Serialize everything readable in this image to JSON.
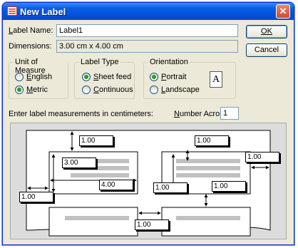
{
  "title": "New Label",
  "label_name": {
    "caption_u": "L",
    "caption_rest": "abel Name:",
    "value": "Label1"
  },
  "dimensions": {
    "caption": "Dimensions:",
    "value": "3.00 cm x 4.00 cm"
  },
  "buttons": {
    "ok": "OK",
    "cancel": "Cancel"
  },
  "unit_of_measure": {
    "title": "Unit of Measure",
    "options": [
      {
        "u": "E",
        "rest": "nglish",
        "selected": false
      },
      {
        "u": "M",
        "rest": "etric",
        "selected": true
      }
    ]
  },
  "label_type": {
    "title": "Label Type",
    "options": [
      {
        "u": "S",
        "rest": "heet feed",
        "selected": true
      },
      {
        "u": "C",
        "rest": "ontinuous",
        "selected": false
      }
    ]
  },
  "orientation": {
    "title": "Orientation",
    "options": [
      {
        "u": "P",
        "rest": "ortrait",
        "selected": true
      },
      {
        "u": "L",
        "rest": "andscape",
        "selected": false
      }
    ],
    "preview_letter": "A"
  },
  "instruction": "Enter label measurements in centimeters:",
  "number_across": {
    "caption_u": "N",
    "caption_rest": "umber Across:",
    "value": "1"
  },
  "measurements": {
    "top_margin": "1.00",
    "label_height": "3.00",
    "label_width": "4.00",
    "side_margin": "1.00",
    "right_top": "1.00",
    "right_margin": "1.00",
    "vertical_pitch": "1.00",
    "horizontal_gap": "1.00"
  }
}
